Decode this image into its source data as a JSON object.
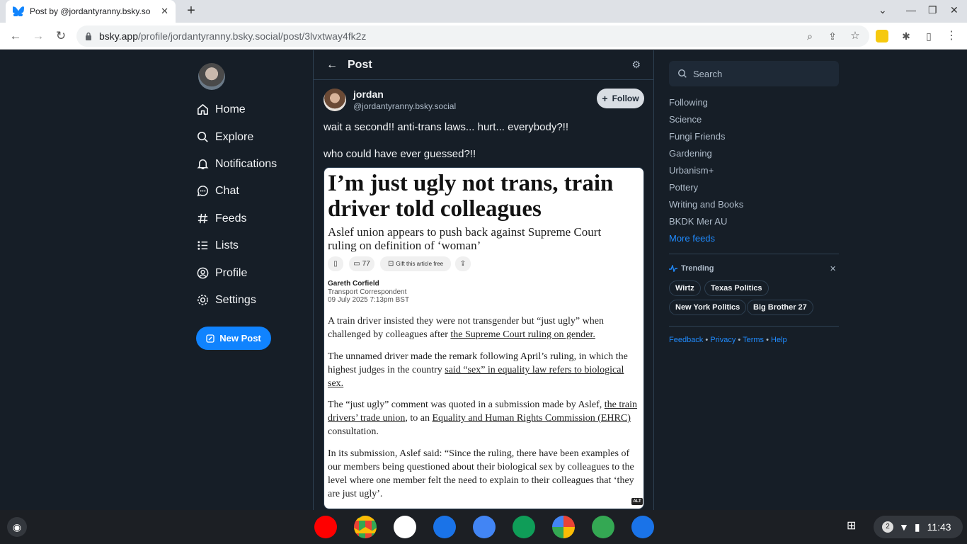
{
  "browser": {
    "tab_title": "Post by @jordantyranny.bsky.so",
    "url_host": "bsky.app",
    "url_path": "/profile/jordantyranny.bsky.social/post/3lvxtway4fk2z"
  },
  "nav": {
    "items": [
      {
        "label": "Home",
        "icon": "home-icon"
      },
      {
        "label": "Explore",
        "icon": "search-icon"
      },
      {
        "label": "Notifications",
        "icon": "bell-icon"
      },
      {
        "label": "Chat",
        "icon": "chat-icon"
      },
      {
        "label": "Feeds",
        "icon": "hash-icon"
      },
      {
        "label": "Lists",
        "icon": "list-icon"
      },
      {
        "label": "Profile",
        "icon": "user-icon"
      },
      {
        "label": "Settings",
        "icon": "gear-icon"
      }
    ],
    "new_post": "New Post"
  },
  "post": {
    "header": "Post",
    "author_name": "jordan",
    "author_handle": "@jordantyranny.bsky.social",
    "follow": "Follow",
    "text1": "wait a second!! anti-trans laws... hurt... everybody?!!",
    "text2": "who could have ever guessed?!!",
    "image": {
      "headline": "I’m just ugly not trans, train driver told colleagues",
      "subheading": "Aslef union appears to push back against Supreme Court ruling on definition of ‘woman’",
      "comments": "77",
      "gift": "Gift this article free",
      "author": "Gareth Corfield",
      "role": "Transport Correspondent",
      "date": "09 July 2025 7:13pm BST",
      "p1a": "A train driver insisted they were not transgender but “just ugly” when challenged by colleagues after ",
      "p1b": "the Supreme Court ruling on gender.",
      "p2a": "The unnamed driver made the remark following April’s ruling, in which the highest judges in the country ",
      "p2b": "said “sex” in equality law refers to biological sex.",
      "p3a": "The “just ugly” comment was quoted in a submission made by Aslef, ",
      "p3b": "the train drivers’ trade union",
      "p3c": ", to an ",
      "p3d": "Equality and Human Rights Commission (EHRC)",
      "p3e": " consultation.",
      "p4": "In its submission, Aslef said: “Since the ruling, there have been examples of our members being questioned about their biological sex by colleagues to the level where one member felt the need to explain to their colleagues that ‘they are just ugly’.",
      "alt": "ALT"
    }
  },
  "sidebar": {
    "search_placeholder": "Search",
    "feeds": [
      "Following",
      "Science",
      "Fungi Friends",
      "Gardening",
      "Urbanism+",
      "Pottery",
      "Writing and Books",
      "BKDK Mer AU"
    ],
    "more_feeds": "More feeds",
    "trending_label": "Trending",
    "trends": [
      "Wirtz",
      "Texas Politics",
      "New York Politics",
      "Big Brother 27"
    ],
    "footer": [
      "Feedback",
      "Privacy",
      "Terms",
      "Help"
    ]
  },
  "shelf": {
    "time": "11:43",
    "notif_count": "2"
  }
}
